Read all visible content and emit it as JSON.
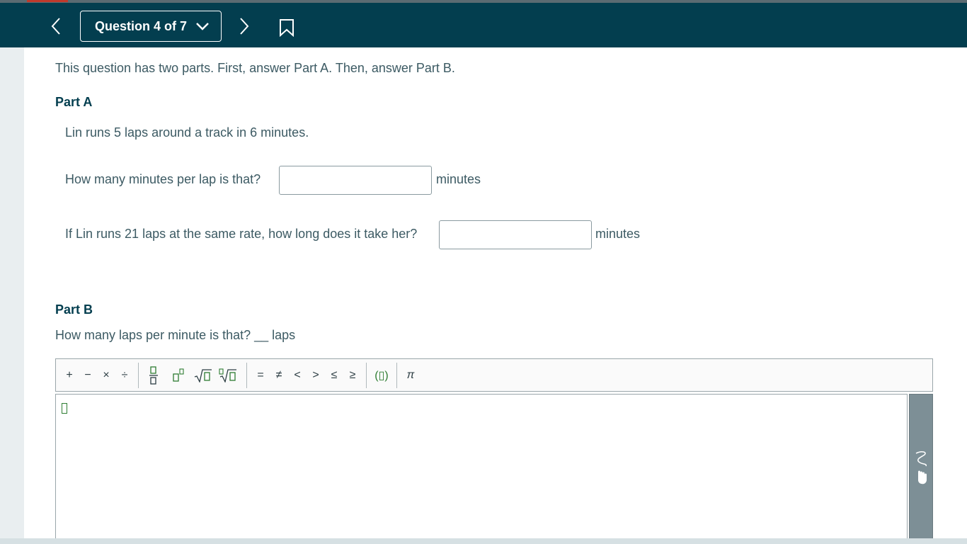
{
  "header": {
    "question_selector": "Question 4 of 7",
    "prev_icon": "chevron-left-icon",
    "next_icon": "chevron-right-icon",
    "bookmark_icon": "bookmark-icon",
    "background_color": "#033e4f"
  },
  "question": {
    "intro": "This question has two parts. First, answer Part A. Then, answer Part B.",
    "part_a": {
      "heading": "Part A",
      "stem": "Lin runs 5 laps around a track in 6 minutes.",
      "q1": {
        "prompt": "How many minutes per lap is that?",
        "value": "",
        "unit": "minutes"
      },
      "q2": {
        "prompt": "If Lin runs 21 laps at the same rate, how long does it take her?",
        "value": "",
        "unit": "minutes"
      }
    },
    "part_b": {
      "heading": "Part B",
      "prompt": "How many laps per minute is that? __ laps"
    }
  },
  "math_toolbar": {
    "basic_ops": [
      "+",
      "−",
      "×",
      "÷"
    ],
    "structures": [
      "fraction",
      "exponent",
      "square-root",
      "nth-root"
    ],
    "relations": [
      "=",
      "≠",
      "<",
      ">",
      "≤",
      "≥"
    ],
    "grouping": "(▯)",
    "constants": [
      "π"
    ]
  },
  "editor": {
    "value": "",
    "side_tool_icon": "handwriting-hand-icon"
  }
}
